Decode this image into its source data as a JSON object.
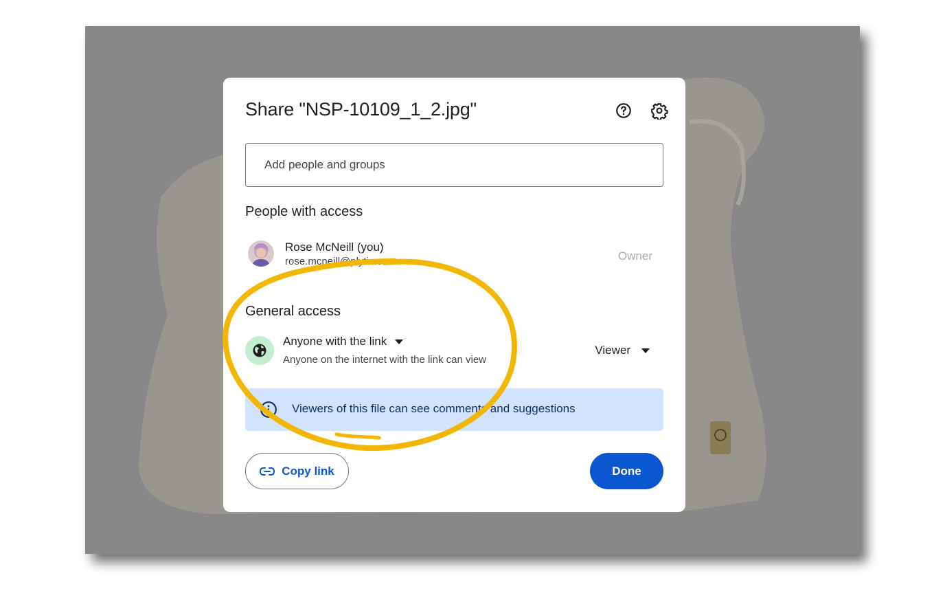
{
  "dialog": {
    "title": "Share \"NSP-10109_1_2.jpg\"",
    "help_icon": "help-circle-icon",
    "settings_icon": "gear-icon"
  },
  "add_people": {
    "placeholder": "Add people and groups"
  },
  "people_section": {
    "heading": "People with access",
    "people": [
      {
        "name": "Rose McNeill (you)",
        "email": "rose.mcneill@plytix.com",
        "role": "Owner"
      }
    ]
  },
  "general_access": {
    "heading": "General access",
    "access_label": "Anyone with the link",
    "access_description": "Anyone on the internet with the link can view",
    "role": "Viewer",
    "icon": "globe-icon"
  },
  "info_banner": {
    "text": "Viewers of this file can see comments and suggestions",
    "icon": "info-icon"
  },
  "footer": {
    "copy_link_label": "Copy link",
    "done_label": "Done"
  },
  "colors": {
    "primary": "#0b57d0",
    "banner_bg": "#d3e3fd",
    "globe_bg": "#c4eed0",
    "annotation": "#f2b705"
  }
}
